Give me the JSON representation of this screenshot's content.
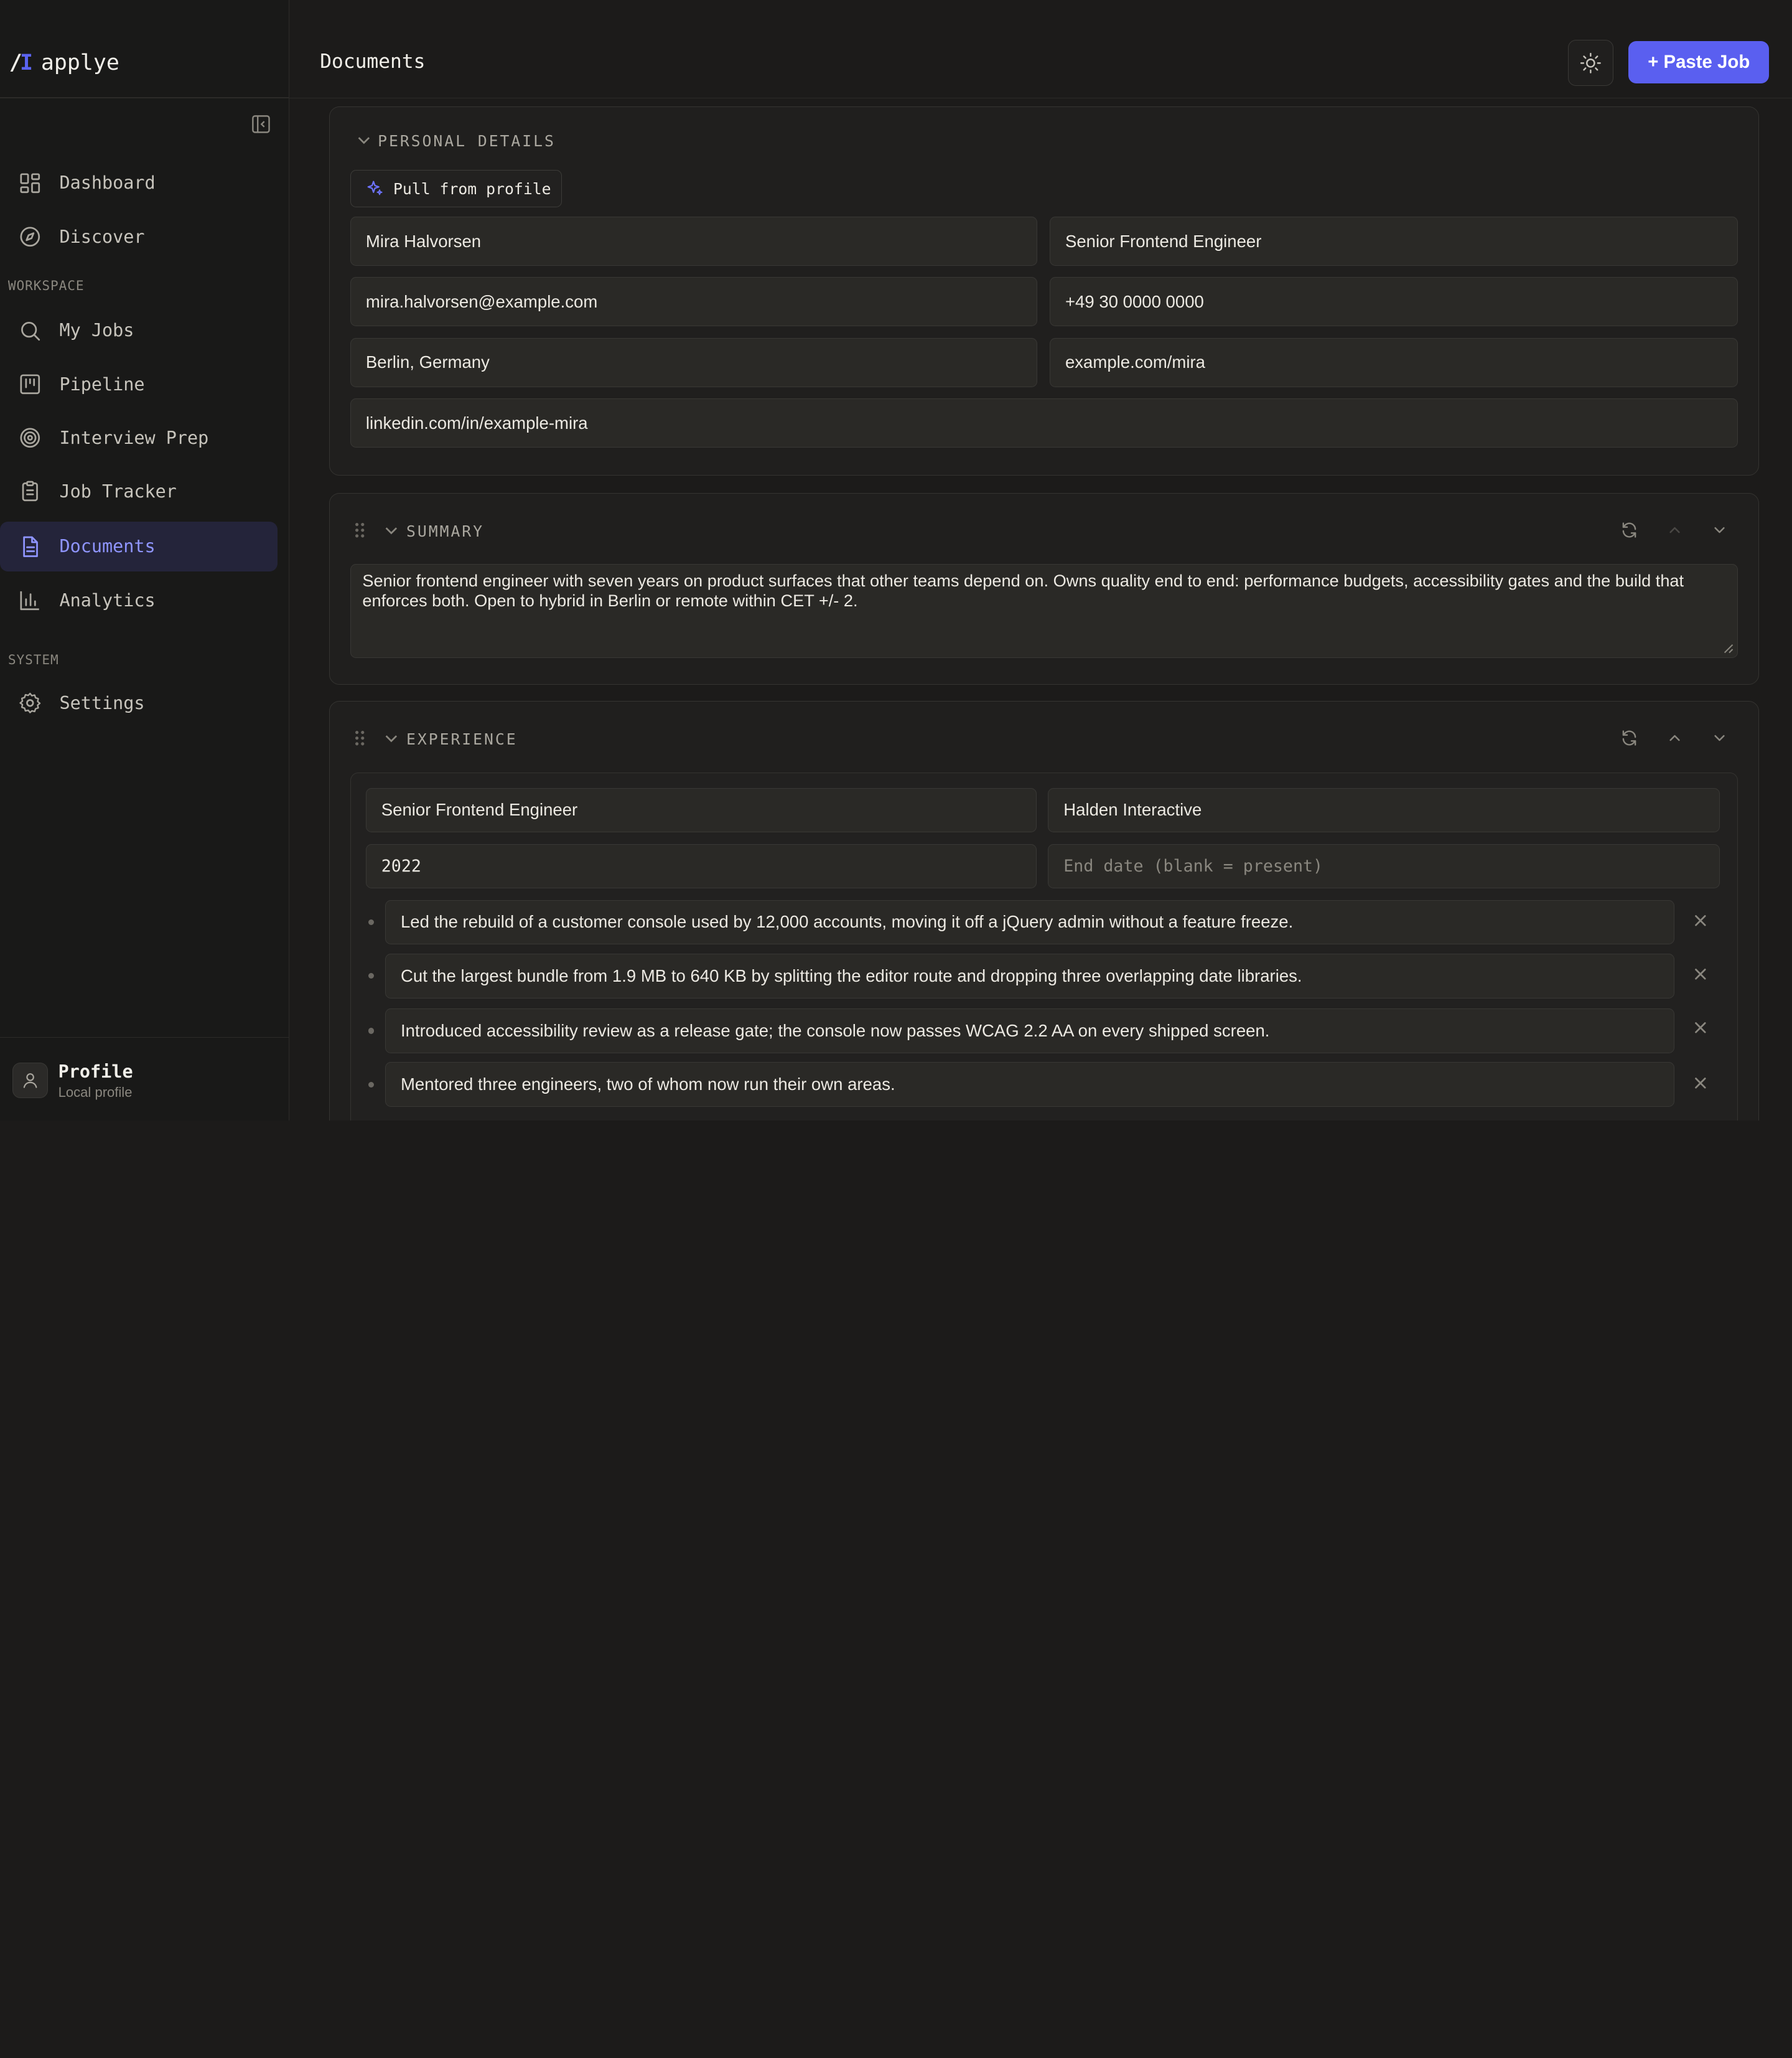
{
  "brand": {
    "name": "applye",
    "mark_slash": "/",
    "mark_bar": "I"
  },
  "sidebar": {
    "nav_top": [
      {
        "label": "Dashboard",
        "icon": "dashboard-icon"
      },
      {
        "label": "Discover",
        "icon": "compass-icon"
      }
    ],
    "workspace_label": "WORKSPACE",
    "workspace": [
      {
        "label": "My Jobs",
        "icon": "search-icon"
      },
      {
        "label": "Pipeline",
        "icon": "kanban-icon"
      },
      {
        "label": "Interview Prep",
        "icon": "target-icon"
      },
      {
        "label": "Job Tracker",
        "icon": "clipboard-icon"
      },
      {
        "label": "Documents",
        "icon": "document-icon",
        "active": true
      },
      {
        "label": "Analytics",
        "icon": "bar-chart-icon"
      }
    ],
    "system_label": "SYSTEM",
    "system": [
      {
        "label": "Settings",
        "icon": "gear-icon"
      }
    ],
    "profile": {
      "name": "Profile",
      "subtitle": "Local profile"
    }
  },
  "header": {
    "title": "Documents",
    "paste_job_label": "+ Paste Job"
  },
  "personal_details": {
    "title": "PERSONAL DETAILS",
    "pull_label": "Pull from profile",
    "name": "Mira Halvorsen",
    "headline": "Senior Frontend Engineer",
    "email": "mira.halvorsen@example.com",
    "phone": "+49 30 0000 0000",
    "location": "Berlin, Germany",
    "website": "example.com/mira",
    "linkedin": "linkedin.com/in/example-mira"
  },
  "summary": {
    "title": "SUMMARY",
    "text": "Senior frontend engineer with seven years on product surfaces that other teams depend on. Owns quality end to end: performance budgets, accessibility gates and the build that enforces both. Open to hybrid in Berlin or remote within CET +/- 2."
  },
  "experience": {
    "title": "EXPERIENCE",
    "role": "Senior Frontend Engineer",
    "company": "Halden Interactive",
    "start": "2022",
    "end_placeholder": "End date (blank = present)",
    "bullets": [
      "Led the rebuild of a customer console used by 12,000 accounts, moving it off a jQuery admin without a feature freeze.",
      "Cut the largest bundle from 1.9 MB to 640 KB by splitting the editor route and dropping three overlapping date libraries.",
      "Introduced accessibility review as a release gate; the console now passes WCAG 2.2 AA on every shipped screen.",
      "Mentored three engineers, two of whom now run their own areas."
    ]
  },
  "colors": {
    "accent": "#5a5ff0",
    "active_nav_bg": "#24243a",
    "active_nav_text": "#8f95ff",
    "background": "#1c1b1a"
  }
}
